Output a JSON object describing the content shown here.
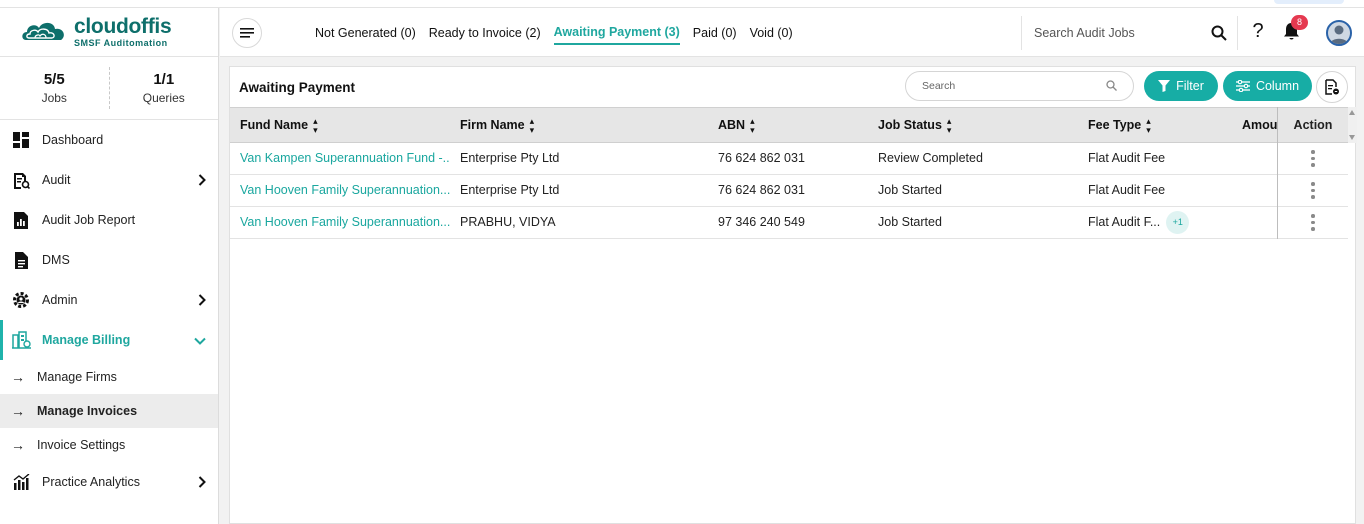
{
  "app": {
    "brand": "cloudoffis",
    "tagline": "SMSF Auditomation"
  },
  "stats": [
    {
      "value": "5/5",
      "label": "Jobs"
    },
    {
      "value": "1/1",
      "label": "Queries"
    }
  ],
  "sidebar": {
    "items": [
      {
        "label": "Dashboard"
      },
      {
        "label": "Audit"
      },
      {
        "label": "Audit Job Report"
      },
      {
        "label": "DMS"
      },
      {
        "label": "Admin"
      },
      {
        "label": "Manage Billing"
      }
    ],
    "sub_items": [
      {
        "label": "Manage Firms"
      },
      {
        "label": "Manage Invoices"
      },
      {
        "label": "Invoice Settings"
      }
    ],
    "last_item": {
      "label": "Practice Analytics"
    }
  },
  "header": {
    "tabs": [
      {
        "label": "Not Generated (0)"
      },
      {
        "label": "Ready to Invoice (2)"
      },
      {
        "label": "Awaiting Payment (3)"
      },
      {
        "label": "Paid (0)"
      },
      {
        "label": "Void (0)"
      }
    ],
    "search_placeholder": "Search Audit Jobs",
    "help_label": "?",
    "notification_count": "8"
  },
  "panel": {
    "title": "Awaiting Payment",
    "search_placeholder": "Search",
    "filter_label": "Filter",
    "column_label": "Column"
  },
  "table": {
    "columns": [
      "Fund Name",
      "Firm Name",
      "ABN",
      "Job Status",
      "Fee Type",
      "Amour",
      "Action"
    ],
    "rows": [
      {
        "fund": "Van Kampen Superannuation Fund -...",
        "firm": "Enterprise Pty Ltd",
        "abn": "76 624 862 031",
        "status": "Review Completed",
        "fee": "Flat Audit Fee",
        "extra": ""
      },
      {
        "fund": "Van Hooven Family Superannuation...",
        "firm": "Enterprise Pty Ltd",
        "abn": "76 624 862 031",
        "status": "Job Started",
        "fee": "Flat Audit Fee",
        "extra": ""
      },
      {
        "fund": "Van Hooven Family Superannuation...",
        "firm": "PRABHU, VIDYA",
        "abn": "97 346 240 549",
        "status": "Job Started",
        "fee": "Flat Audit F...",
        "extra": "+1"
      }
    ]
  },
  "colors": {
    "accent": "#17ada5",
    "brand": "#0e6f6b",
    "badge": "#e53950"
  }
}
